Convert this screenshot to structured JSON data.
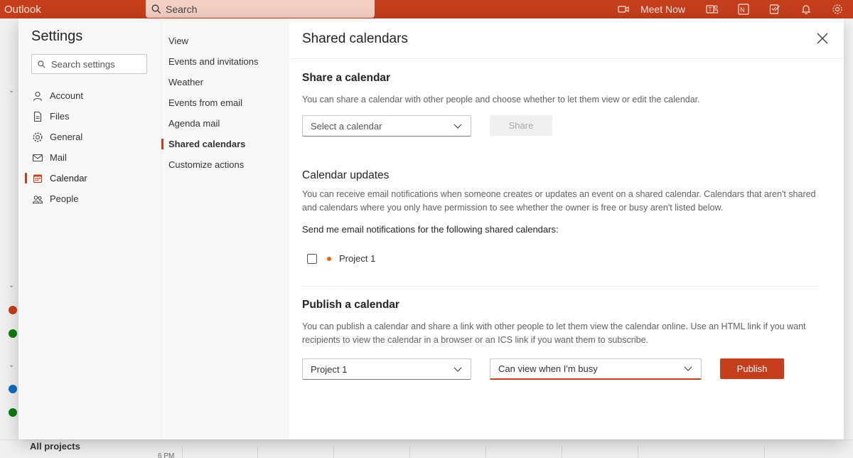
{
  "topbar": {
    "app_title": "Outlook",
    "search_label": "Search",
    "meet_now": "Meet Now"
  },
  "background": {
    "all_projects": "All projects",
    "time_label": "6 PM",
    "mark_colors": [
      "#c43e1c",
      "#107c10",
      "#0f6cbd",
      "#107c10"
    ]
  },
  "settings": {
    "title": "Settings",
    "search_placeholder": "Search settings",
    "categories": [
      {
        "label": "Account",
        "icon": "person-icon"
      },
      {
        "label": "Files",
        "icon": "file-icon"
      },
      {
        "label": "General",
        "icon": "gear-icon"
      },
      {
        "label": "Mail",
        "icon": "mail-icon"
      },
      {
        "label": "Calendar",
        "icon": "calendar-icon",
        "active": true
      },
      {
        "label": "People",
        "icon": "people-icon"
      }
    ],
    "subcategories": [
      {
        "label": "View"
      },
      {
        "label": "Events and invitations"
      },
      {
        "label": "Weather"
      },
      {
        "label": "Events from email"
      },
      {
        "label": "Agenda mail"
      },
      {
        "label": "Shared calendars",
        "active": true
      },
      {
        "label": "Customize actions"
      }
    ]
  },
  "panel": {
    "title": "Shared calendars",
    "share": {
      "heading": "Share a calendar",
      "description": "You can share a calendar with other people and choose whether to let them view or edit the calendar.",
      "dropdown_placeholder": "Select a calendar",
      "share_button": "Share"
    },
    "updates": {
      "heading": "Calendar updates",
      "description": "You can receive email notifications when someone creates or updates an event on a shared calendar. Calendars that aren't shared and calendars where you only have permission to see whether the owner is free or busy aren't listed below.",
      "prompt": "Send me email notifications for the following shared calendars:",
      "calendars": [
        {
          "name": "Project 1",
          "checked": false,
          "color": "#e8650a"
        }
      ]
    },
    "publish": {
      "heading": "Publish a calendar",
      "description": "You can publish a calendar and share a link with other people to let them view the calendar online. Use an HTML link if you want recipients to view the calendar in a browser or an ICS link if you want them to subscribe.",
      "calendar_value": "Project 1",
      "permission_value": "Can view when I'm busy",
      "publish_button": "Publish"
    }
  },
  "colors": {
    "accent": "#c43e1c",
    "topbar": "#c43e1c"
  }
}
